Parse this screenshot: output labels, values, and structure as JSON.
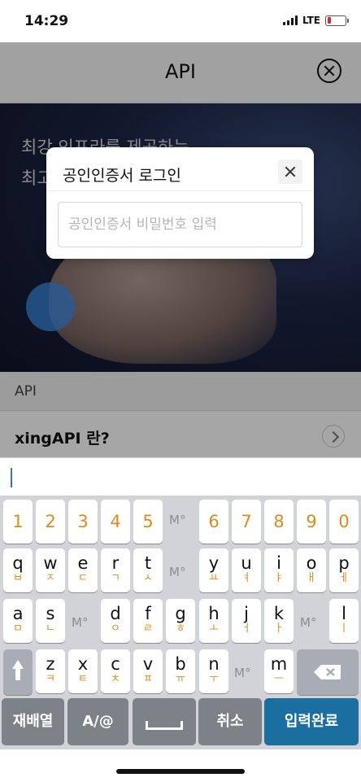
{
  "status": {
    "time": "14:29",
    "network": "LTE",
    "battery_level": 0.22
  },
  "header": {
    "title": "API"
  },
  "hero": {
    "line1": "최강 인프라를 제공하는",
    "line2": "최고"
  },
  "section": {
    "label": "API"
  },
  "list": {
    "item1": "xingAPI 란?"
  },
  "dialog": {
    "title": "공인인증서 로그인",
    "password_placeholder": "공인인증서 비밀번호 입력"
  },
  "keyboard": {
    "numbers": [
      "1",
      "2",
      "3",
      "4",
      "5",
      "6",
      "7",
      "8",
      "9",
      "0"
    ],
    "row1": [
      {
        "main": "q",
        "sub": "ㅂ"
      },
      {
        "main": "w",
        "sub": "ㅈ"
      },
      {
        "main": "e",
        "sub": "ㄷ"
      },
      {
        "main": "r",
        "sub": "ㄱ"
      },
      {
        "main": "t",
        "sub": "ㅅ"
      },
      {
        "main": "y",
        "sub": "ㅛ"
      },
      {
        "main": "u",
        "sub": "ㅕ"
      },
      {
        "main": "i",
        "sub": "ㅑ"
      },
      {
        "main": "o",
        "sub": "ㅐ"
      },
      {
        "main": "p",
        "sub": "ㅔ"
      }
    ],
    "row2": [
      {
        "main": "a",
        "sub": "ㅁ"
      },
      {
        "main": "s",
        "sub": "ㄴ"
      },
      {
        "main": "d",
        "sub": "ㅇ"
      },
      {
        "main": "f",
        "sub": "ㄹ"
      },
      {
        "main": "g",
        "sub": "ㅎ"
      },
      {
        "main": "h",
        "sub": "ㅗ"
      },
      {
        "main": "j",
        "sub": "ㅓ"
      },
      {
        "main": "k",
        "sub": "ㅏ"
      },
      {
        "main": "l",
        "sub": "ㅣ"
      }
    ],
    "row3": [
      {
        "main": "z",
        "sub": "ㅋ"
      },
      {
        "main": "x",
        "sub": "ㅌ"
      },
      {
        "main": "c",
        "sub": "ㅊ"
      },
      {
        "main": "v",
        "sub": "ㅍ"
      },
      {
        "main": "b",
        "sub": "ㅠ"
      },
      {
        "main": "n",
        "sub": "ㅜ"
      },
      {
        "main": "m",
        "sub": "ㅡ"
      }
    ],
    "mo_label": "M°",
    "shuffle_label": "재배열",
    "mode_label": "A/@",
    "cancel_label": "취소",
    "done_label": "입력완료"
  }
}
